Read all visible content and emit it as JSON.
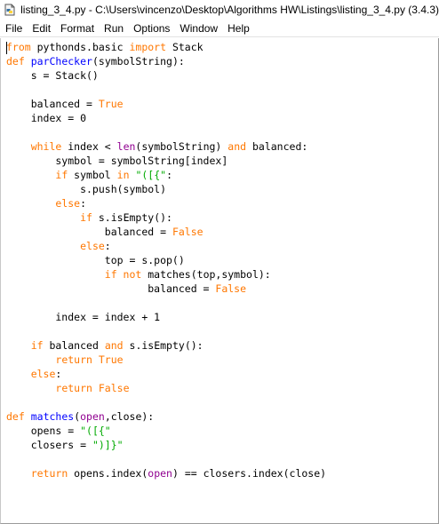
{
  "window": {
    "title": "listing_3_4.py - C:\\Users\\vincenzo\\Desktop\\Algorithms HW\\Listings\\listing_3_4.py (3.4.3)",
    "icon": "python-file-icon"
  },
  "menu": [
    "File",
    "Edit",
    "Format",
    "Run",
    "Options",
    "Window",
    "Help"
  ],
  "colors": {
    "keyword": "#ff7700",
    "builtin": "#900090",
    "string": "#00aa00",
    "definition": "#0000ff"
  },
  "code": [
    [
      {
        "t": "kw",
        "v": "from"
      },
      {
        "t": "",
        "v": " pythonds.basic "
      },
      {
        "t": "kw",
        "v": "import"
      },
      {
        "t": "",
        "v": " Stack"
      }
    ],
    [
      {
        "t": "kw",
        "v": "def"
      },
      {
        "t": "",
        "v": " "
      },
      {
        "t": "def",
        "v": "parChecker"
      },
      {
        "t": "",
        "v": "(symbolString):"
      }
    ],
    [
      {
        "t": "",
        "v": "    s = Stack()"
      }
    ],
    [],
    [
      {
        "t": "",
        "v": "    balanced = "
      },
      {
        "t": "kw",
        "v": "True"
      }
    ],
    [
      {
        "t": "",
        "v": "    index = 0"
      }
    ],
    [],
    [
      {
        "t": "",
        "v": "    "
      },
      {
        "t": "kw",
        "v": "while"
      },
      {
        "t": "",
        "v": " index < "
      },
      {
        "t": "bi",
        "v": "len"
      },
      {
        "t": "",
        "v": "(symbolString) "
      },
      {
        "t": "kw",
        "v": "and"
      },
      {
        "t": "",
        "v": " balanced:"
      }
    ],
    [
      {
        "t": "",
        "v": "        symbol = symbolString[index]"
      }
    ],
    [
      {
        "t": "",
        "v": "        "
      },
      {
        "t": "kw",
        "v": "if"
      },
      {
        "t": "",
        "v": " symbol "
      },
      {
        "t": "kw",
        "v": "in"
      },
      {
        "t": "",
        "v": " "
      },
      {
        "t": "str",
        "v": "\"([{\""
      },
      {
        "t": "",
        "v": ":"
      }
    ],
    [
      {
        "t": "",
        "v": "            s.push(symbol)"
      }
    ],
    [
      {
        "t": "",
        "v": "        "
      },
      {
        "t": "kw",
        "v": "else"
      },
      {
        "t": "",
        "v": ":"
      }
    ],
    [
      {
        "t": "",
        "v": "            "
      },
      {
        "t": "kw",
        "v": "if"
      },
      {
        "t": "",
        "v": " s.isEmpty():"
      }
    ],
    [
      {
        "t": "",
        "v": "                balanced = "
      },
      {
        "t": "kw",
        "v": "False"
      }
    ],
    [
      {
        "t": "",
        "v": "            "
      },
      {
        "t": "kw",
        "v": "else"
      },
      {
        "t": "",
        "v": ":"
      }
    ],
    [
      {
        "t": "",
        "v": "                top = s.pop()"
      }
    ],
    [
      {
        "t": "",
        "v": "                "
      },
      {
        "t": "kw",
        "v": "if not"
      },
      {
        "t": "",
        "v": " matches(top,symbol):"
      }
    ],
    [
      {
        "t": "",
        "v": "                       balanced = "
      },
      {
        "t": "kw",
        "v": "False"
      }
    ],
    [],
    [
      {
        "t": "",
        "v": "        index = index + 1"
      }
    ],
    [],
    [
      {
        "t": "",
        "v": "    "
      },
      {
        "t": "kw",
        "v": "if"
      },
      {
        "t": "",
        "v": " balanced "
      },
      {
        "t": "kw",
        "v": "and"
      },
      {
        "t": "",
        "v": " s.isEmpty():"
      }
    ],
    [
      {
        "t": "",
        "v": "        "
      },
      {
        "t": "kw",
        "v": "return"
      },
      {
        "t": "",
        "v": " "
      },
      {
        "t": "kw",
        "v": "True"
      }
    ],
    [
      {
        "t": "",
        "v": "    "
      },
      {
        "t": "kw",
        "v": "else"
      },
      {
        "t": "",
        "v": ":"
      }
    ],
    [
      {
        "t": "",
        "v": "        "
      },
      {
        "t": "kw",
        "v": "return"
      },
      {
        "t": "",
        "v": " "
      },
      {
        "t": "kw",
        "v": "False"
      }
    ],
    [],
    [
      {
        "t": "kw",
        "v": "def"
      },
      {
        "t": "",
        "v": " "
      },
      {
        "t": "def",
        "v": "matches"
      },
      {
        "t": "",
        "v": "("
      },
      {
        "t": "bi",
        "v": "open"
      },
      {
        "t": "",
        "v": ",close):"
      }
    ],
    [
      {
        "t": "",
        "v": "    opens = "
      },
      {
        "t": "str",
        "v": "\"([{\""
      }
    ],
    [
      {
        "t": "",
        "v": "    closers = "
      },
      {
        "t": "str",
        "v": "\")]}\""
      }
    ],
    [],
    [
      {
        "t": "",
        "v": "    "
      },
      {
        "t": "kw",
        "v": "return"
      },
      {
        "t": "",
        "v": " opens.index("
      },
      {
        "t": "bi",
        "v": "open"
      },
      {
        "t": "",
        "v": ") == closers.index(close)"
      }
    ]
  ]
}
